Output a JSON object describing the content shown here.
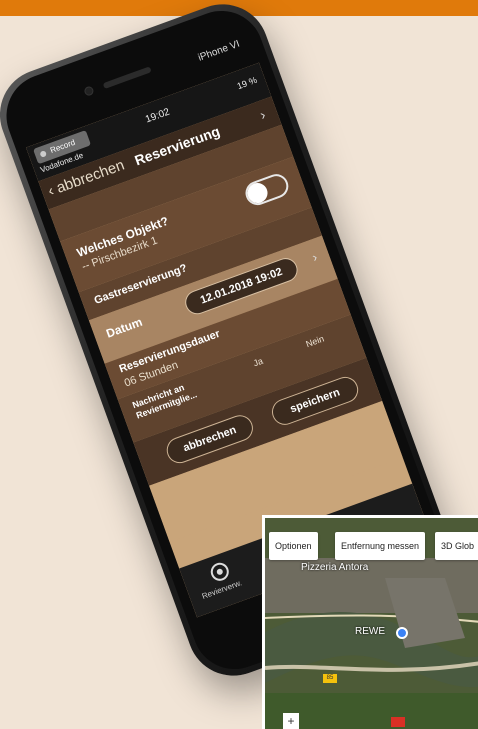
{
  "phone": {
    "model": "iPhone VI",
    "status": {
      "record": "Record",
      "carrier": "Vodafone.de",
      "time": "19:02",
      "battery": "19 %"
    },
    "nav": {
      "back_label": "abbrechen",
      "title": "Reservierung"
    },
    "form": {
      "object_question": "Welches Objekt?",
      "object_value": "-- Pirschbezirk 1",
      "guest_question": "Gastreservierung?",
      "date_label": "Datum",
      "date_value": "12.01.2018 19:02",
      "duration_label": "Reservierungsdauer",
      "duration_value": "06 Stunden",
      "message_label": "Nachricht an Reviermitglie...",
      "option_yes": "Ja",
      "option_no": "Nein"
    },
    "buttons": {
      "cancel": "abbrechen",
      "save": "speichern"
    },
    "tabbar": {
      "label": "Revierverw."
    }
  },
  "map": {
    "buttons": [
      "Optionen",
      "Entfernung messen",
      "3D Glob"
    ],
    "labels": {
      "restaurant": "Pizzeria Antora",
      "store": "REWE"
    },
    "road_number": "85",
    "zoom": "+"
  }
}
